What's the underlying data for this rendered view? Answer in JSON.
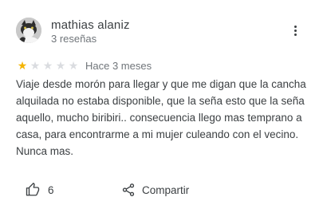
{
  "review": {
    "author_name": "mathias alaniz",
    "author_meta": "3 reseñas",
    "rating": 1,
    "max_rating": 5,
    "date": "Hace 3 meses",
    "text": "Viaje desde morón para llegar y que me digan que la cancha alquilada no estaba disponible, que la seña esto que la seña aquello, mucho biribiri.. consecuencia llego mas temprano a casa, para encontrarme a mi mujer culeando con el vecino. Nunca mas."
  },
  "actions": {
    "likes_count": "6",
    "share_label": "Compartir"
  },
  "icons": {
    "avatar": "avatar-cat-photo",
    "more": "more-vert-icon",
    "like": "thumb-up-icon",
    "share": "share-icon"
  },
  "colors": {
    "star_on": "#f4b400",
    "star_off": "#dadce0",
    "text": "#3c4043",
    "secondary": "#70757a"
  }
}
